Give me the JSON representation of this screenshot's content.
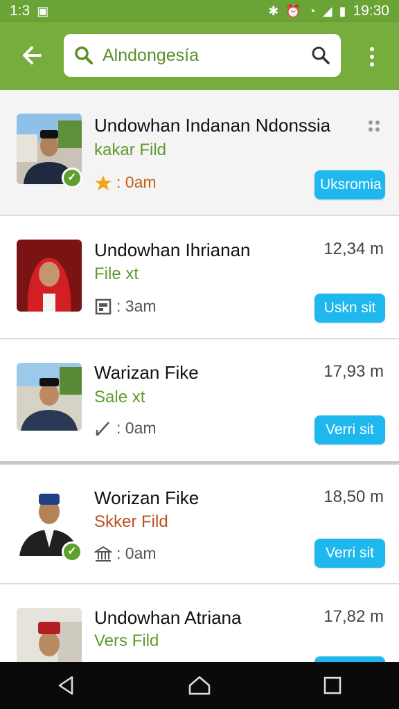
{
  "status": {
    "left_time": "1:3",
    "right_time": "19:30"
  },
  "search": {
    "value": "Alndongesía"
  },
  "items": [
    {
      "name": "Undowhan Indanan Ndonssia",
      "subtitle": "kakar Fild",
      "meta": ": 0am",
      "meta_icon": "star-icon",
      "distance": "",
      "button": "Uksromia",
      "verified": true
    },
    {
      "name": "Undowhan Ihrianan",
      "subtitle": "File xt",
      "meta": ": 3am",
      "meta_icon": "calendar-icon",
      "distance": "12,34 m",
      "button": "Uskn sit",
      "verified": false
    },
    {
      "name": "Warizan Fike",
      "subtitle": "Sale xt",
      "meta": ": 0am",
      "meta_icon": "pen-icon",
      "distance": "17,93 m",
      "button": "Verri sit",
      "verified": false
    },
    {
      "name": "Worizan Fike",
      "subtitle": "Skker Fild",
      "meta": ": 0am",
      "meta_icon": "building-icon",
      "distance": "18,50 m",
      "button": "Verri sit",
      "verified": true
    },
    {
      "name": "Undowhan Atriana",
      "subtitle": "Vers Fild",
      "meta": "",
      "meta_icon": "star-icon",
      "distance": "17,82 m",
      "button": "",
      "verified": false
    }
  ],
  "colors": {
    "appbar": "#76ad3d",
    "accent_green": "#5e9a2c",
    "button_blue": "#1fb8ee"
  }
}
